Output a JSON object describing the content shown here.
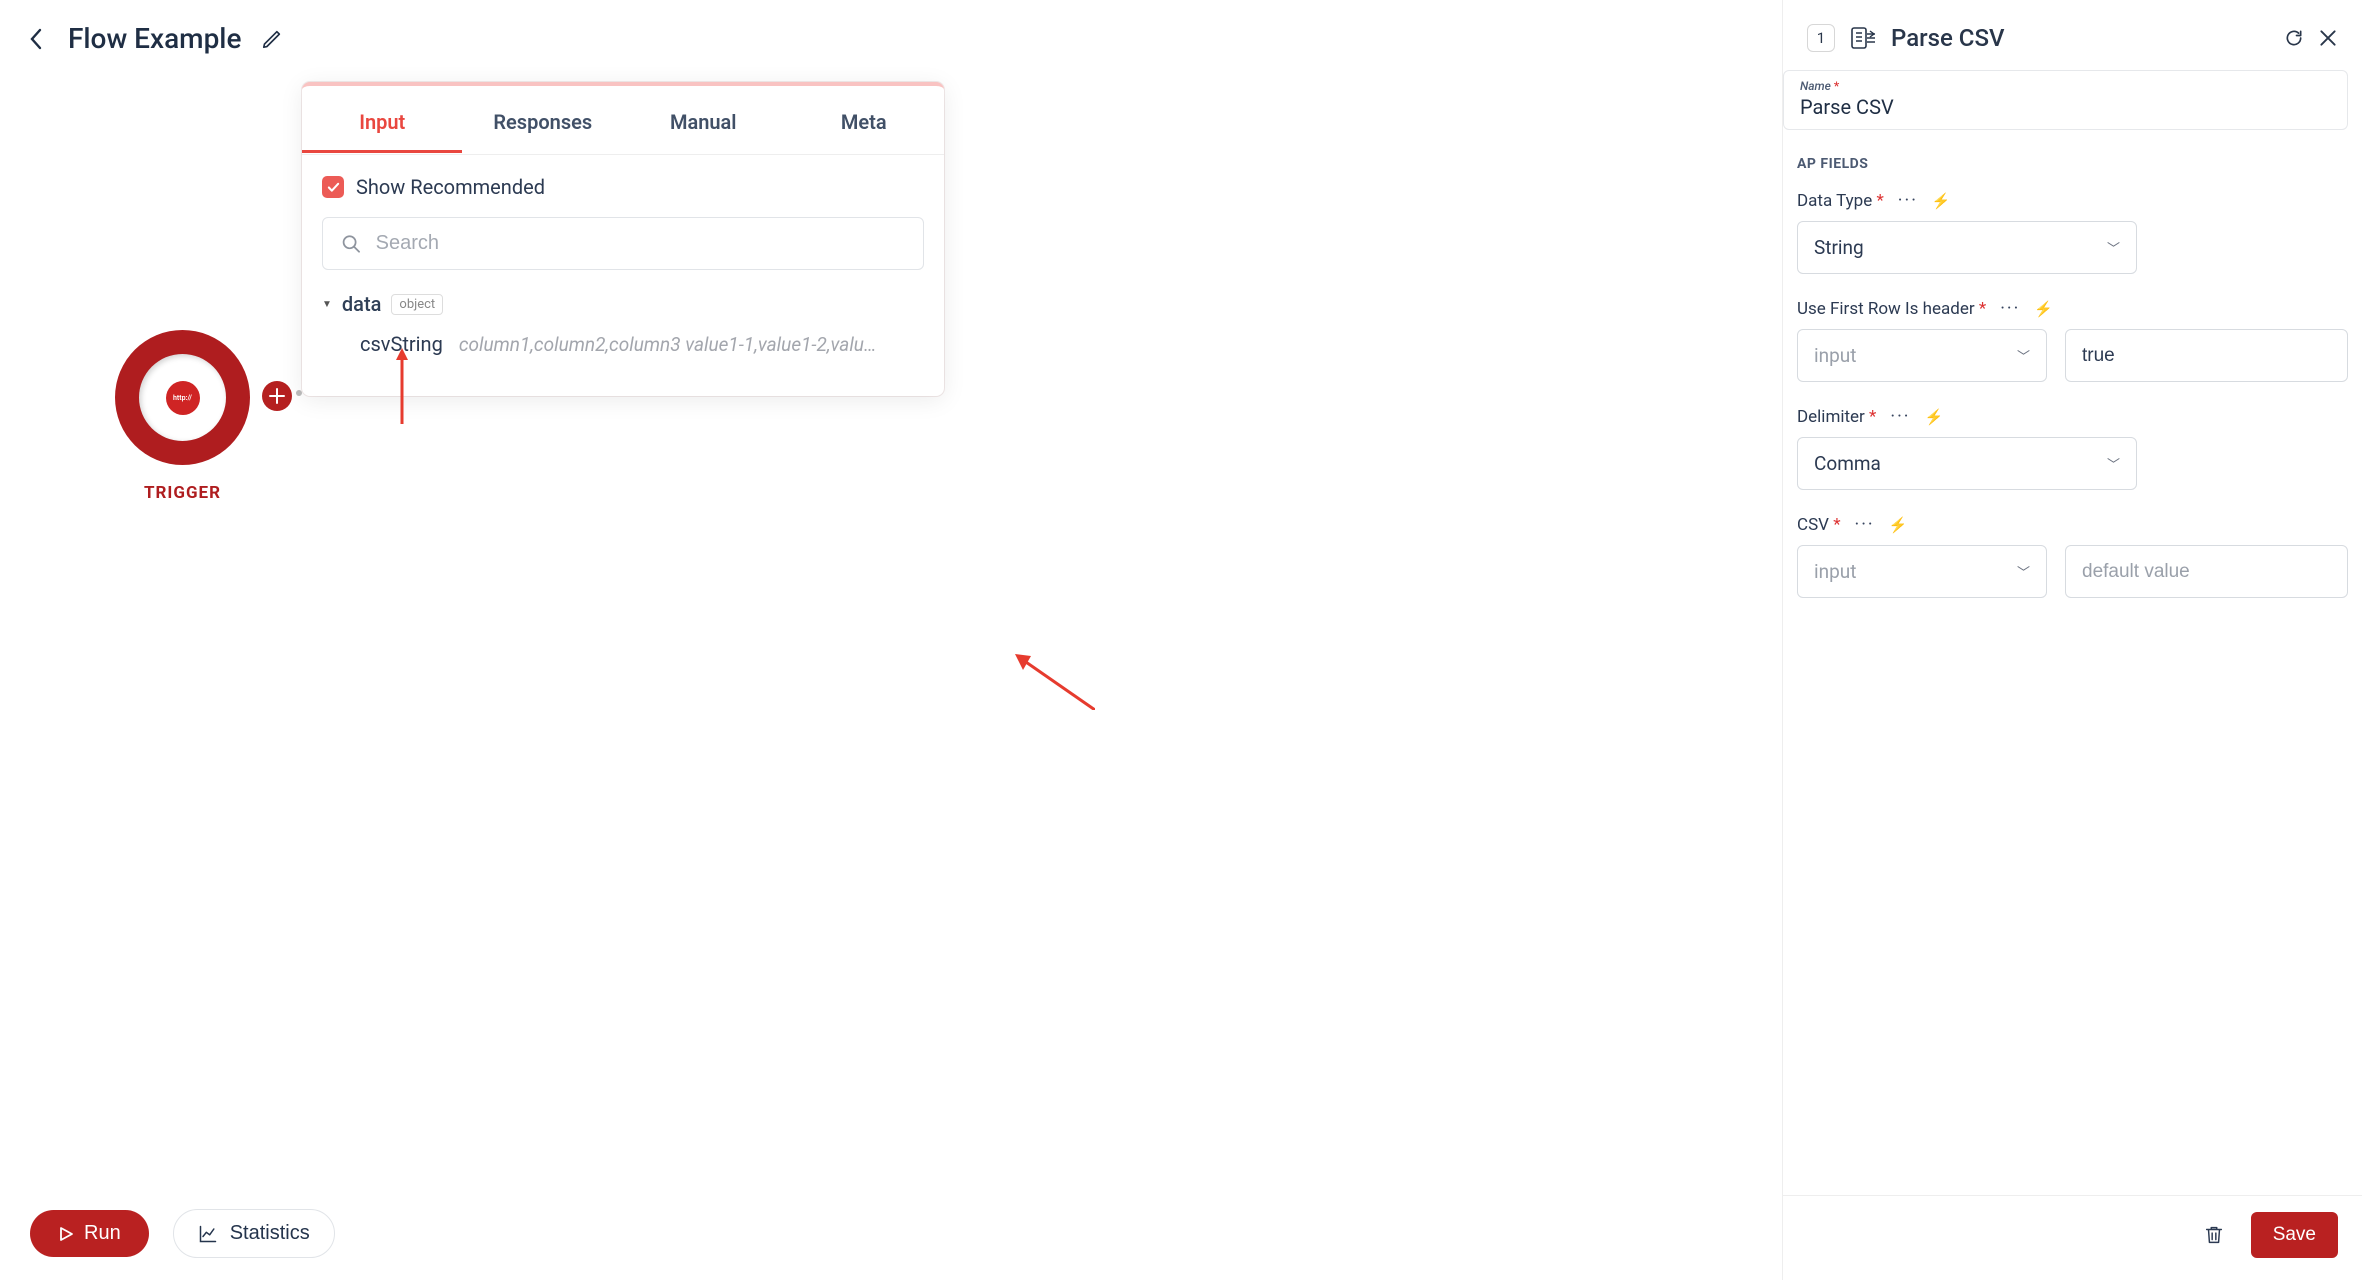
{
  "header": {
    "flow_title": "Flow Example"
  },
  "canvas": {
    "trigger_label": "TRIGGER",
    "trigger_icon_text": "http://"
  },
  "popover": {
    "tabs": [
      "Input",
      "Responses",
      "Manual",
      "Meta"
    ],
    "active_tab": "Input",
    "show_recommended_label": "Show Recommended",
    "show_recommended_checked": true,
    "search_placeholder": "Search",
    "tree": {
      "root_label": "data",
      "root_type": "object",
      "child_key": "csvString",
      "child_value": "column1,column2,column3 value1-1,value1-2,value1-3 value..."
    }
  },
  "sidepanel": {
    "step": "1",
    "title": "Parse CSV",
    "name_field": {
      "label": "Name",
      "value": "Parse CSV"
    },
    "section_title": "AP FIELDS",
    "fields": {
      "data_type": {
        "label": "Data Type",
        "value": "String"
      },
      "use_first_row": {
        "label": "Use First Row Is header",
        "select_value": "input",
        "text_value": "true"
      },
      "delimiter": {
        "label": "Delimiter",
        "value": "Comma"
      },
      "csv": {
        "label": "CSV",
        "select_value": "input",
        "text_placeholder": "default value",
        "text_value": ""
      }
    },
    "save_label": "Save"
  },
  "bottom": {
    "run_label": "Run",
    "stats_label": "Statistics"
  },
  "colors": {
    "brand_red": "#b92121",
    "accent_red": "#e9473f"
  }
}
